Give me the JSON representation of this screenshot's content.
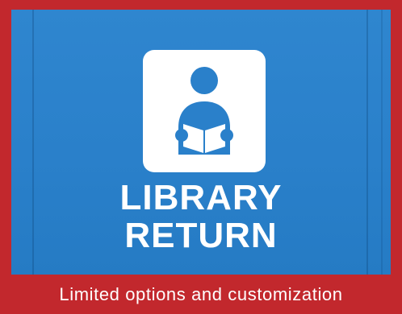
{
  "sign": {
    "icon": "person-reading-book-icon",
    "line1": "LIBRARY",
    "line2": "RETURN"
  },
  "caption": {
    "text": "Limited options and customization"
  },
  "colors": {
    "frame": "#c2282d",
    "sign_background": "#2a80ca",
    "icon_box": "#ffffff",
    "text": "#ffffff"
  }
}
